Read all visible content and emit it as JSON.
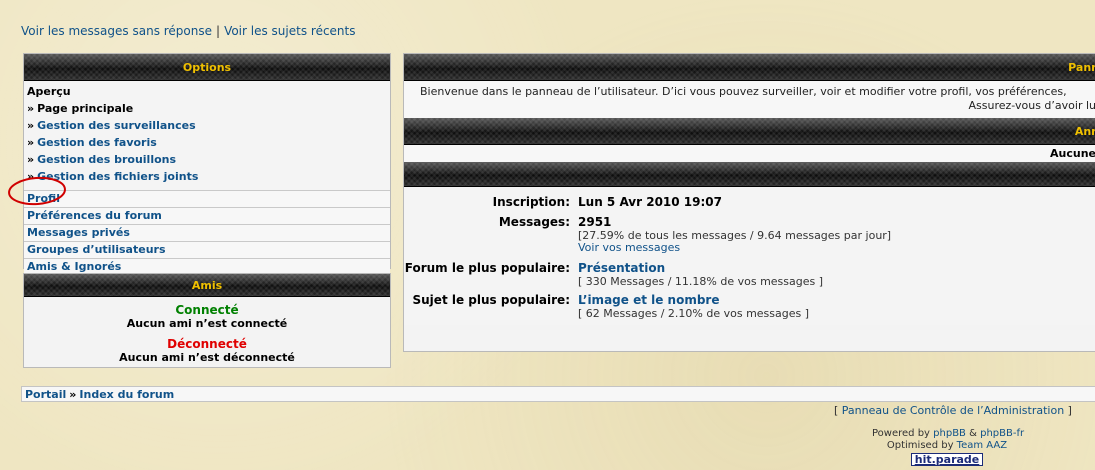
{
  "top_links": {
    "unanswered": "Voir les messages sans réponse",
    "separator": "|",
    "recent": "Voir les sujets récents"
  },
  "options": {
    "title": "Options",
    "section_title": "Aperçu",
    "overview_items": [
      {
        "label": "Page principale",
        "current": true
      },
      {
        "label": "Gestion des surveillances",
        "current": false
      },
      {
        "label": "Gestion des favoris",
        "current": false
      },
      {
        "label": "Gestion des brouillons",
        "current": false
      },
      {
        "label": "Gestion des fichiers joints",
        "current": false
      }
    ],
    "rows": [
      "Profil",
      "Préférences du forum",
      "Messages privés",
      "Groupes d’utilisateurs",
      "Amis & Ignorés"
    ]
  },
  "friends": {
    "title": "Amis",
    "online_label": "Connecté",
    "online_none": "Aucun ami n’est connecté",
    "offline_label": "Déconnecté",
    "offline_none": "Aucun ami n’est déconnecté"
  },
  "main": {
    "title": "Pann",
    "welcome_line1": "Bienvenue dans le panneau de l’utilisateur. D’ici vous pouvez surveiller, voir et modifier votre profil, vos préférences,",
    "welcome_line2": "Assurez-vous d’avoir lu",
    "announcements_title": "Ann",
    "announcements_value": "Aucune",
    "stats": {
      "inscription_label": "Inscription:",
      "inscription_value": "Lun 5 Avr 2010 19:07",
      "messages_label": "Messages:",
      "messages_value": "2951",
      "messages_detail": "[27.59% de tous les messages / 9.64 messages par jour]",
      "messages_link": "Voir vos messages",
      "forum_label": "Forum le plus populaire:",
      "forum_value": "Présentation",
      "forum_detail": "[ 330 Messages / 11.18% de vos messages ]",
      "topic_label": "Sujet le plus populaire:",
      "topic_value": "L’image et le nombre",
      "topic_detail": "[ 62 Messages / 2.10% de vos messages ]"
    }
  },
  "breadcrumb": {
    "portal": "Portail",
    "separator": "»",
    "index": "Index du forum"
  },
  "acp_link": {
    "open": "[",
    "label": "Panneau de Contrôle de l’Administration",
    "close": "]"
  },
  "footer": {
    "powered_prefix": "Powered by",
    "phpbb": "phpBB",
    "amp": "&",
    "phpbb_fr": "phpBB-fr",
    "optimised_prefix": "Optimised by",
    "team": "Team AAZ",
    "badge": "hit.parade"
  },
  "colors": {
    "link": "#105289",
    "header_text": "#f0c000",
    "online": "#008000",
    "offline": "#e00000",
    "highlight_circle": "#d00000"
  }
}
